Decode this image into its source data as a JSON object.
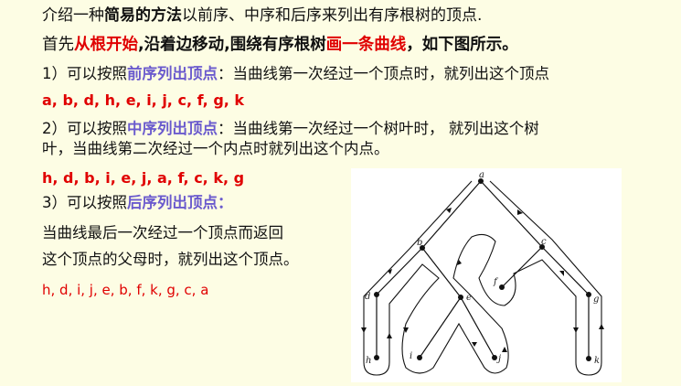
{
  "intro": {
    "prefix": "介绍一种",
    "highlight": "简易的方法",
    "suffix": "以前序、中序和后序来列出有序根树的顶点."
  },
  "instruction": {
    "part1": "首先",
    "part2": "从根开始",
    "part3": ",沿着边移动,围绕有序根树",
    "part4": "画一条曲线",
    "part5": "，如下图所示。"
  },
  "preorder": {
    "number": "1）可以按照",
    "method": "前序列出顶点",
    "description": "：当曲线第一次经过一个顶点时，就列出这个顶点",
    "sequence": "a, b, d, h, e,  i,  j, c, f, g, k"
  },
  "inorder": {
    "number": "2）可以按照",
    "method": "中序列出顶点",
    "description_line1": "：当曲线第一次经过一个树叶时，  就列出这个树",
    "description_line2": "叶，当曲线第二次经过一个内点时就列出这个内点。",
    "sequence": "h, d, b,  i, e,  j, a, f, c, k, g"
  },
  "postorder": {
    "number": "3）可以按照",
    "method": "后序列出顶点：",
    "description_line1": "当曲线最后一次经过一个顶点而返回",
    "description_line2": "这个顶点的父母时，就列出这个顶点。",
    "sequence": "h, d, i, j, e, b, f, k, g, c, a"
  },
  "tree": {
    "node_labels": [
      "a",
      "b",
      "c",
      "d",
      "e",
      "f",
      "g",
      "h",
      "i",
      "j",
      "k"
    ]
  }
}
